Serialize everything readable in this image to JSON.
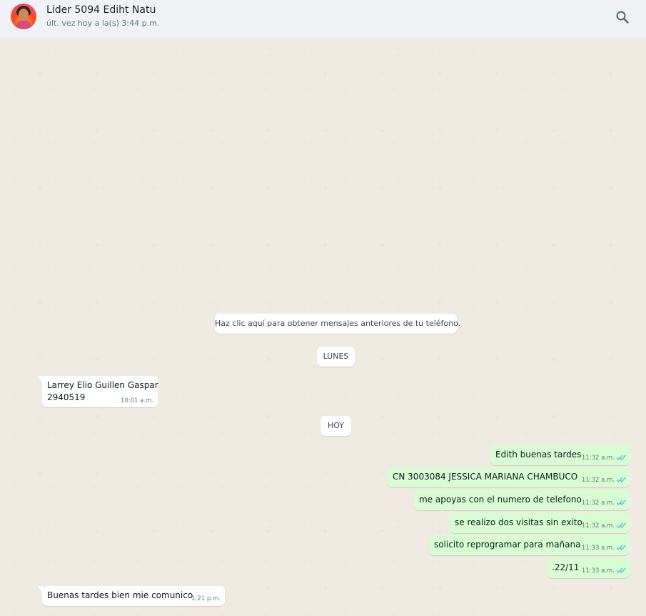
{
  "header": {
    "contact_name": "Lider 5094 Ediht Natu",
    "last_seen": "últ. vez hoy a la(s) 3:44 p.m.",
    "search_icon": "search-icon"
  },
  "chat": {
    "load_older": "Haz clic aquí para obtener mensajes anteriores de tu teléfono.",
    "date_monday": "LUNES",
    "date_today": "HOY",
    "messages": [
      {
        "direction": "in",
        "line1": "Larrey Elio Guillen Gaspar",
        "line2": "2940519",
        "time": "10:01 a.m."
      },
      {
        "direction": "out",
        "text": "Edith buenas tardes",
        "time": "11:32 a.m.",
        "status": "read"
      },
      {
        "direction": "out",
        "text": "CN 3003084  JESSICA MARIANA  CHAMBUCO",
        "time": "11:32 a.m.",
        "status": "read"
      },
      {
        "direction": "out",
        "text": "me apoyas con el numero de telefono",
        "time": "11:32 a.m.",
        "status": "read"
      },
      {
        "direction": "out",
        "text": "se realizo dos visitas sin exito",
        "time": "11:32 a.m.",
        "status": "read"
      },
      {
        "direction": "out",
        "text": "solicito reprogramar para mañana",
        "time": "11:33 a.m.",
        "status": "read"
      },
      {
        "direction": "out",
        "text": ".22/11",
        "time": "11:33 a.m.",
        "status": "read"
      },
      {
        "direction": "in",
        "text": "Buenas tardes bien mie comunico",
        "time": "1:21 p.m."
      }
    ]
  },
  "colors": {
    "chat_background": "#efeae2",
    "outgoing_bubble": "#d9fdd3",
    "incoming_bubble": "#ffffff",
    "read_ticks": "#53bdeb"
  }
}
